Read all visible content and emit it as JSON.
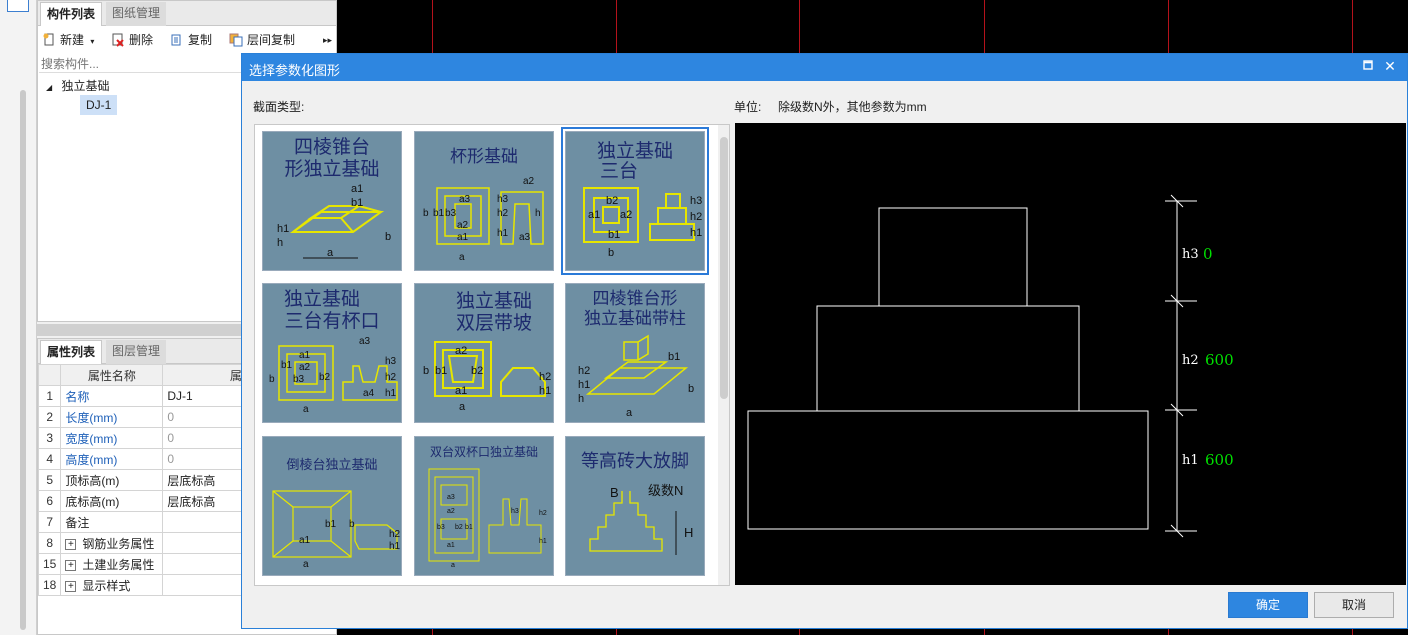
{
  "component_panel": {
    "tabs": [
      "构件列表",
      "图纸管理"
    ],
    "toolbar": {
      "new": "新建",
      "delete": "删除",
      "copy": "复制",
      "floor_copy": "层间复制",
      "more": "▸▸"
    },
    "search_placeholder": "搜索构件...",
    "tree": {
      "root": "独立基础",
      "child": "DJ-1",
      "expander": "◢"
    }
  },
  "property_panel": {
    "tabs": [
      "属性列表",
      "图层管理"
    ],
    "columns": [
      "属性名称",
      "属性值"
    ],
    "rows": [
      {
        "num": "1",
        "name": "名称",
        "value": "DJ-1"
      },
      {
        "num": "2",
        "name": "长度(mm)",
        "value": "0"
      },
      {
        "num": "3",
        "name": "宽度(mm)",
        "value": "0"
      },
      {
        "num": "4",
        "name": "高度(mm)",
        "value": "0"
      },
      {
        "num": "5",
        "name": "顶标高(m)",
        "value": "层底标高"
      },
      {
        "num": "6",
        "name": "底标高(m)",
        "value": "层底标高"
      },
      {
        "num": "7",
        "name": "备注",
        "value": ""
      },
      {
        "num": "8",
        "name": "钢筋业务属性",
        "value": ""
      },
      {
        "num": "15",
        "name": "土建业务属性",
        "value": ""
      },
      {
        "num": "18",
        "name": "显示样式",
        "value": ""
      }
    ],
    "plus": "+"
  },
  "dialog": {
    "title": "选择参数化图形",
    "section_label": "截面类型:",
    "unit_label": "单位:",
    "unit_text": "除级数N外，其他参数为mm",
    "close": "✕",
    "ok": "确定",
    "cancel": "取消",
    "shapes": [
      {
        "title": "四棱锥台形独立基础",
        "line1": "四棱锥台",
        "line2": "形独立基础",
        "selected": false
      },
      {
        "title": "杯形基础",
        "line1": "杯形基础",
        "line2": "",
        "selected": false
      },
      {
        "title": "独立基础三台",
        "line1": "独立基础",
        "line2": "三台",
        "selected": true
      },
      {
        "title": "独立基础三台有杯口",
        "line1": "独立基础",
        "line2": "三台有杯口",
        "selected": false
      },
      {
        "title": "独立基础双层带坡",
        "line1": "独立基础",
        "line2": "双层带坡",
        "selected": false
      },
      {
        "title": "四棱锥台形独立基础带柱",
        "line1": "四棱锥台形",
        "line2": "独立基础带柱",
        "selected": false
      },
      {
        "title": "倒棱台独立基础",
        "line1": "倒棱台独立基础",
        "line2": "",
        "selected": false
      },
      {
        "title": "双台双杯口独立基础",
        "line1": "双台双杯口独立基础",
        "line2": "",
        "selected": false
      },
      {
        "title": "等高砖大放脚",
        "line1": "等高砖大放脚",
        "line2": "",
        "selected": false
      }
    ],
    "preview": {
      "h3_label": "h3",
      "h3_value": "0",
      "h2_label": "h2",
      "h2_value": "600",
      "h1_label": "h1",
      "h1_value": "600"
    },
    "thumb_labels": {
      "t1": [
        "a1",
        "b1",
        "h1",
        "h",
        "a",
        "b"
      ],
      "t2": [
        "a3",
        "b3",
        "b1",
        "b",
        "a2",
        "a1",
        "a",
        "h3",
        "h2",
        "h1",
        "h",
        "a2",
        "a3"
      ],
      "t3": [
        "b2",
        "a1",
        "a2",
        "b1",
        "b",
        "h3",
        "h2",
        "h1"
      ],
      "t4": [
        "a1",
        "a2",
        "a3",
        "a4",
        "b1",
        "b2",
        "b3",
        "b",
        "h3",
        "h2",
        "h1",
        "a"
      ],
      "t5": [
        "a2",
        "b1",
        "b",
        "b2",
        "a1",
        "a",
        "h2",
        "h1"
      ],
      "t6": [
        "h2",
        "h1",
        "h",
        "b1",
        "b",
        "a"
      ],
      "t7": [
        "b1",
        "b",
        "a1",
        "a",
        "h2",
        "h1"
      ],
      "t8": [
        "a3",
        "a2",
        "a1",
        "b3",
        "b2",
        "b1",
        "h3",
        "h2",
        "h1",
        "a"
      ],
      "t9": [
        "B",
        "级数N",
        "H"
      ]
    }
  },
  "colors": {
    "title_blue": "#2e86e0",
    "thumb_bg": "#6e8fa3",
    "cad_line": "#ffffff",
    "value_green": "#00e000",
    "grid_red": "#b4121b",
    "shape_yellow": "#e6e600"
  }
}
